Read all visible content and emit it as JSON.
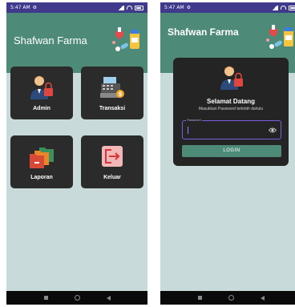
{
  "status_bar": {
    "time_left": "5:47 AM",
    "time_right": "5:47 AM"
  },
  "app": {
    "title": "Shafwan Farma"
  },
  "menu": {
    "admin_label": "Admin",
    "transaksi_label": "Transaksi",
    "laporan_label": "Laporan",
    "keluar_label": "Keluar"
  },
  "login": {
    "welcome": "Selamat Datang",
    "hint": "Masukkan Password terlebih dahulu",
    "password_label": "Password",
    "button_label": "LOGIN"
  },
  "colors": {
    "status_bar": "#3f3a8c",
    "header": "#4e8a78",
    "background": "#c9dadb",
    "tile": "#2b2b2b",
    "field_border": "#7b5de0"
  },
  "icons": [
    "pharmacy-logo-icon",
    "admin-user-icon",
    "cash-register-icon",
    "folders-icon",
    "exit-icon",
    "visibility-eye-icon"
  ]
}
